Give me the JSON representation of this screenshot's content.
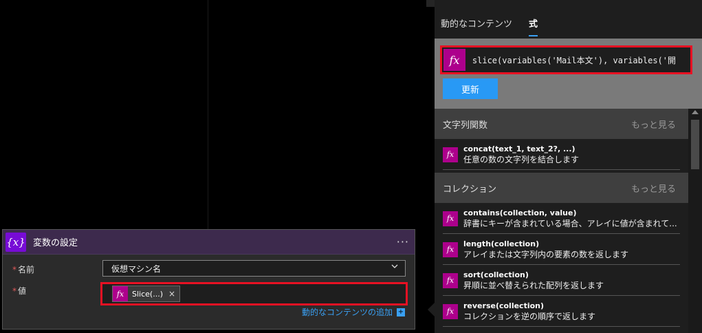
{
  "action_card": {
    "title": "変数の設定",
    "icon": "variable-icon",
    "icon_glyph": "{x}",
    "more_label": "···",
    "name_label": "名前",
    "name_value": "仮想マシン名",
    "value_label": "値",
    "value_token": "Slice(...)",
    "token_remove": "×",
    "required_mark": "*",
    "add_dynamic_label": "動的なコンテンツの追加",
    "add_plus": "+",
    "accent_color": "#770bd6"
  },
  "panel": {
    "tabs": [
      {
        "label": "動的なコンテンツ",
        "active": false
      },
      {
        "label": "式",
        "active": true
      }
    ],
    "fx_glyph": "fx",
    "expression": "slice(variables('Mail本文'), variables('開",
    "update_label": "更新",
    "sections": [
      {
        "title": "文字列関数",
        "more": "もっと見る",
        "items": [
          {
            "name": "concat(text_1, text_2?, ...)",
            "desc": "任意の数の文字列を結合します"
          }
        ]
      },
      {
        "title": "コレクション",
        "more": "もっと見る",
        "items": [
          {
            "name": "contains(collection, value)",
            "desc": "辞書にキーが含まれている場合、アレイに値が含まれて..."
          },
          {
            "name": "length(collection)",
            "desc": "アレイまたは文字列内の要素の数を返します"
          },
          {
            "name": "sort(collection)",
            "desc": "昇順に並べ替えられた配列を返します"
          },
          {
            "name": "reverse(collection)",
            "desc": "コレクションを逆の順序で返します"
          }
        ]
      }
    ],
    "accent_color": "#2899f5",
    "function_color": "#ad008c"
  }
}
